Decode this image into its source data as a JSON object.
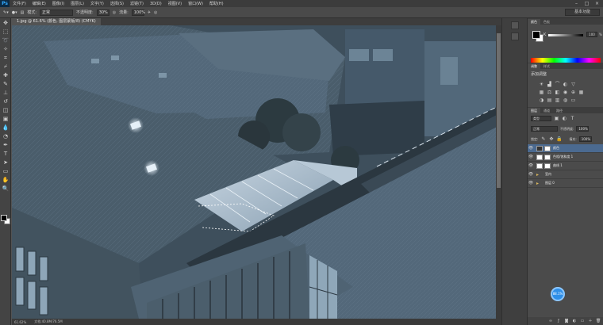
{
  "app": {
    "logo": "Ps"
  },
  "menu": [
    "文件(F)",
    "编辑(E)",
    "图像(I)",
    "图层(L)",
    "文字(Y)",
    "选择(S)",
    "滤镜(T)",
    "3D(D)",
    "视图(V)",
    "窗口(W)",
    "帮助(H)"
  ],
  "options": {
    "mode_label": "模式:",
    "mode_value": "正常",
    "opacity_label": "不透明度:",
    "opacity_value": "30%",
    "flow_label": "流量:",
    "flow_value": "100%",
    "workspace": "基本功能"
  },
  "document": {
    "tab_title": "1.jpg @ 61.6% (颜色, 图层蒙版/8) (CMYK)",
    "zoom": "61.62%",
    "doc_info": "文档:40.8M/76.5M"
  },
  "color_panel": {
    "tabs": [
      "颜色",
      "色板"
    ],
    "k_label": "K",
    "k_value": "100",
    "k_unit": "%"
  },
  "adjust_panel": {
    "tabs": [
      "调整",
      "样式"
    ],
    "title": "添加调整"
  },
  "layers_panel": {
    "tabs": [
      "图层",
      "通道",
      "路径"
    ],
    "kind_filter": "类型",
    "blend_mode": "正常",
    "opacity_label": "不透明度:",
    "opacity_value": "100%",
    "lock_label": "锁定:",
    "fill_label": "填充:",
    "fill_value": "100%",
    "layers": [
      {
        "name": "颜色"
      },
      {
        "name": "色相/饱和度 1"
      },
      {
        "name": "曲线 1"
      },
      {
        "name": "室内"
      },
      {
        "name": "图层 0"
      }
    ]
  },
  "badge": {
    "label": "88.1%"
  },
  "colors": {
    "ui_bg": "#535353",
    "canvas_tint": "#3e4f5c",
    "selected_layer": "#4b6a90",
    "accent_blue": "#2f8fe8"
  }
}
